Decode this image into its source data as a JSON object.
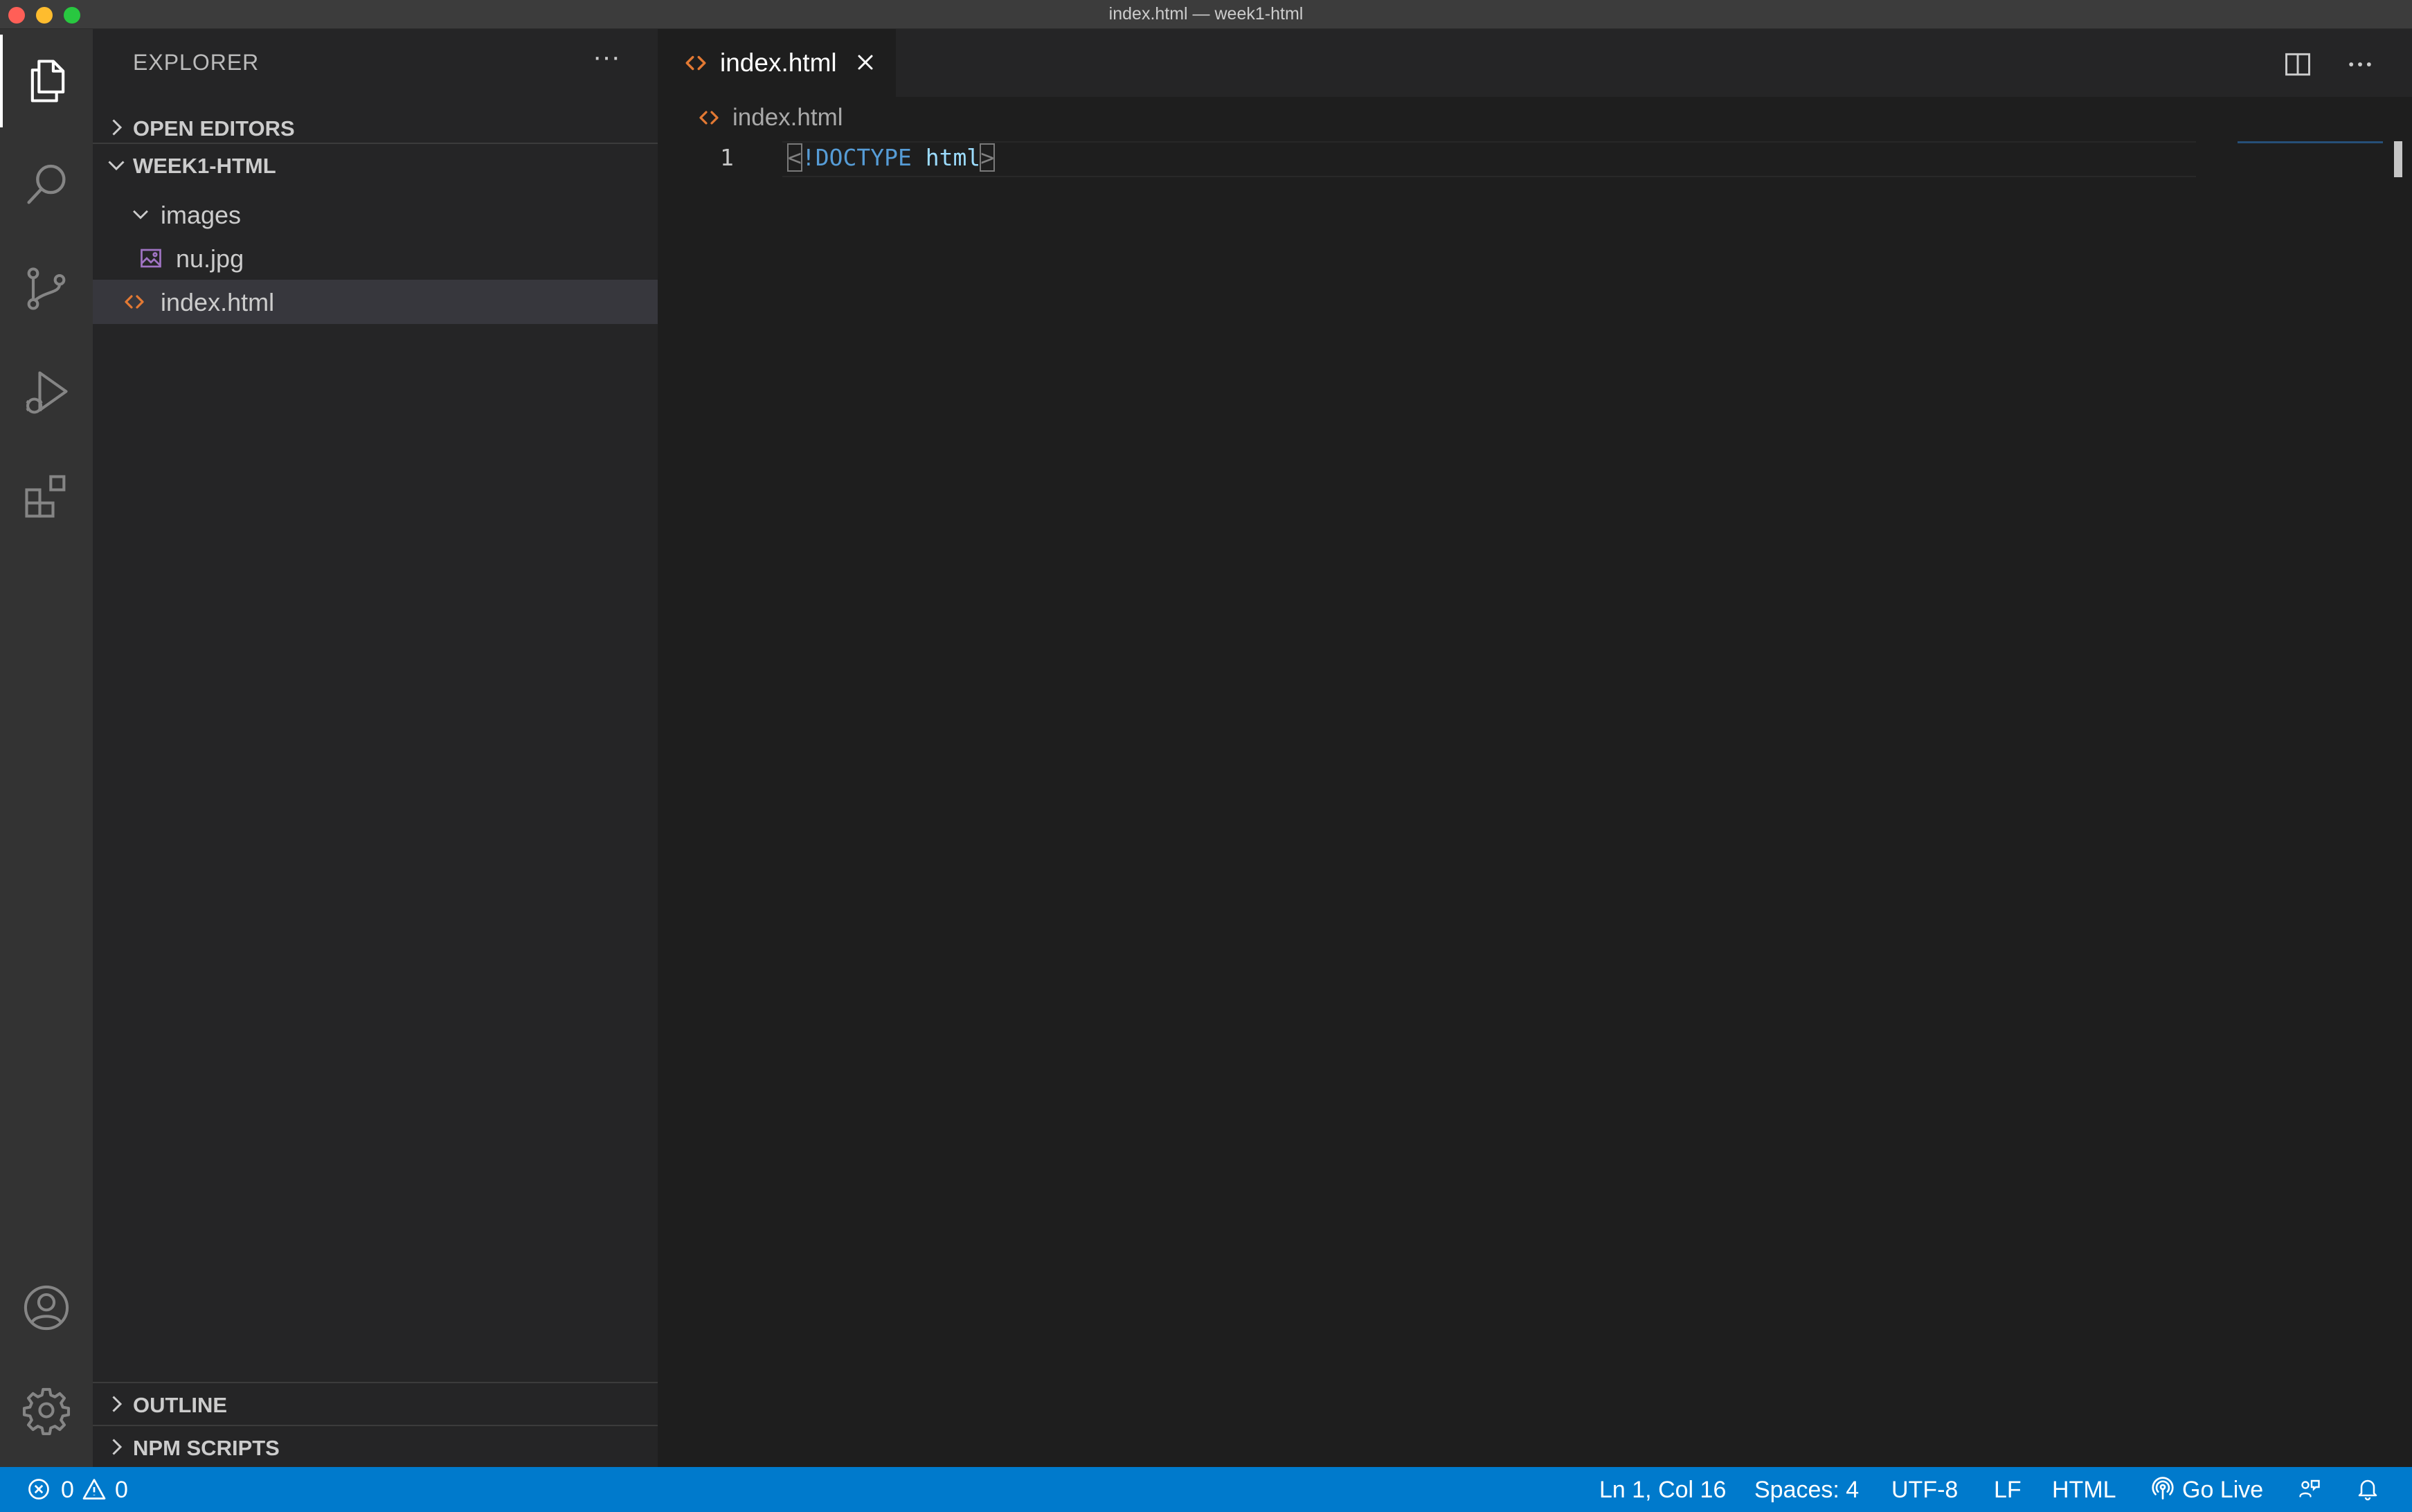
{
  "window": {
    "title": "index.html — week1-html"
  },
  "activity_bar": {
    "items": [
      {
        "name": "explorer-icon",
        "active": true
      },
      {
        "name": "search-icon",
        "active": false
      },
      {
        "name": "source-control-icon",
        "active": false
      },
      {
        "name": "run-debug-icon",
        "active": false
      },
      {
        "name": "extensions-icon",
        "active": false
      }
    ],
    "bottom": [
      {
        "name": "account-icon"
      },
      {
        "name": "gear-icon"
      }
    ]
  },
  "sidebar": {
    "title": "EXPLORER",
    "more_label": "···",
    "open_editors_label": "OPEN EDITORS",
    "folder_label": "WEEK1-HTML",
    "tree": {
      "images_folder": "images",
      "image_file": "nu.jpg",
      "html_file": "index.html"
    },
    "outline_label": "OUTLINE",
    "npm_scripts_label": "NPM SCRIPTS"
  },
  "editor": {
    "tab_label": "index.html",
    "breadcrumb": "index.html",
    "line_number": "1",
    "code": {
      "open": "<",
      "doctype": "!DOCTYPE",
      "space": " ",
      "html": "html",
      "close": ">"
    }
  },
  "statusbar": {
    "errors": "0",
    "warnings": "0",
    "position": "Ln 1, Col 16",
    "spaces": "Spaces: 4",
    "encoding": "UTF-8",
    "eol": "LF",
    "language": "HTML",
    "go_live": "Go Live"
  },
  "colors": {
    "statusbar_bg": "#007acc",
    "html_icon": "#e37933",
    "image_icon": "#a074c4"
  }
}
